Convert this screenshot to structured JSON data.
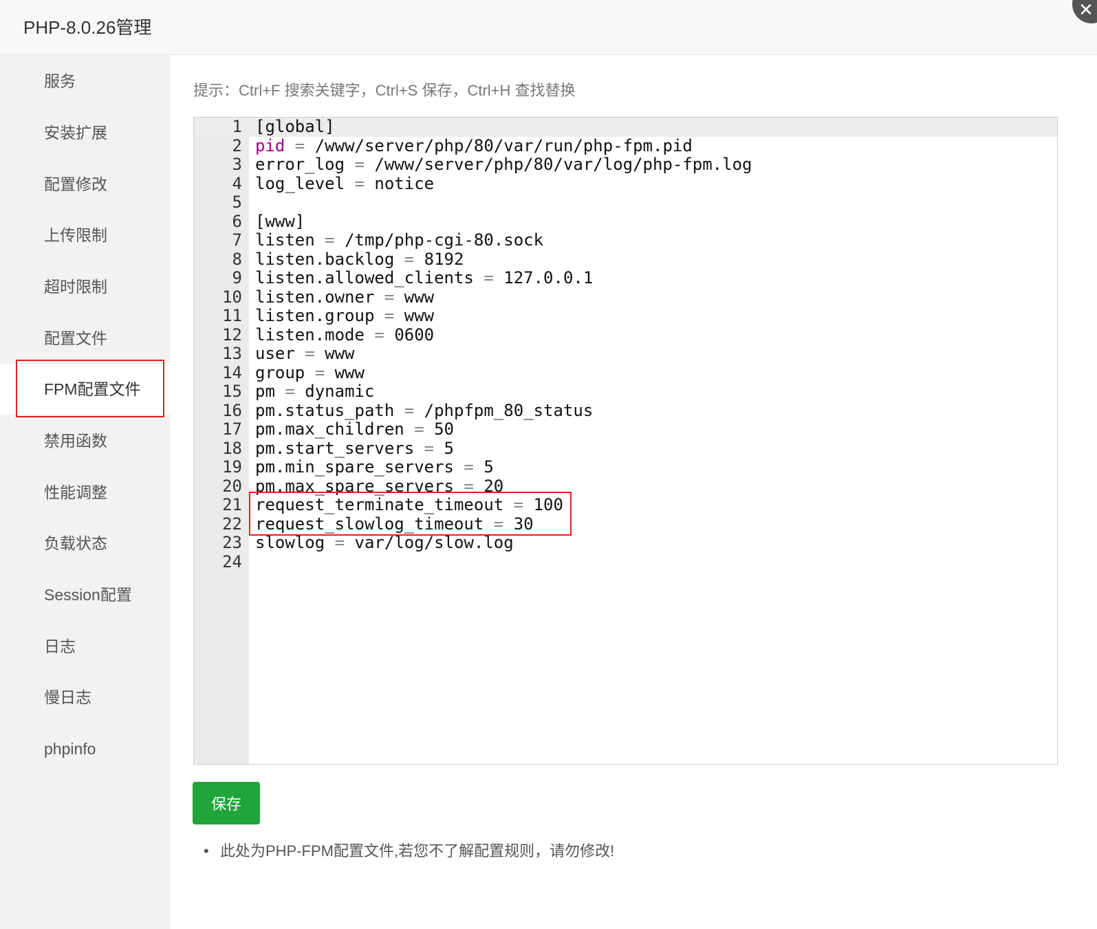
{
  "window": {
    "title": "PHP-8.0.26管理"
  },
  "sidebar": {
    "items": [
      {
        "label": "服务"
      },
      {
        "label": "安装扩展"
      },
      {
        "label": "配置修改"
      },
      {
        "label": "上传限制"
      },
      {
        "label": "超时限制"
      },
      {
        "label": "配置文件"
      },
      {
        "label": "FPM配置文件",
        "active": true
      },
      {
        "label": "禁用函数"
      },
      {
        "label": "性能调整"
      },
      {
        "label": "负载状态"
      },
      {
        "label": "Session配置"
      },
      {
        "label": "日志"
      },
      {
        "label": "慢日志"
      },
      {
        "label": "phpinfo"
      }
    ]
  },
  "main": {
    "hint": "提示：Ctrl+F 搜索关键字，Ctrl+S 保存，Ctrl+H 查找替换",
    "editor": {
      "lines": [
        "[global]",
        "pid = /www/server/php/80/var/run/php-fpm.pid",
        "error_log = /www/server/php/80/var/log/php-fpm.log",
        "log_level = notice",
        "",
        "[www]",
        "listen = /tmp/php-cgi-80.sock",
        "listen.backlog = 8192",
        "listen.allowed_clients = 127.0.0.1",
        "listen.owner = www",
        "listen.group = www",
        "listen.mode = 0600",
        "user = www",
        "group = www",
        "pm = dynamic",
        "pm.status_path = /phpfpm_80_status",
        "pm.max_children = 50",
        "pm.start_servers = 5",
        "pm.min_spare_servers = 5",
        "pm.max_spare_servers = 20",
        "request_terminate_timeout = 100",
        "request_slowlog_timeout = 30",
        "slowlog = var/log/slow.log",
        ""
      ]
    },
    "save_label": "保存",
    "note": "此处为PHP-FPM配置文件,若您不了解配置规则，请勿修改!"
  },
  "colors": {
    "accent": "#20a53a",
    "highlight": "#e02020",
    "keyword": "#a0008f"
  }
}
